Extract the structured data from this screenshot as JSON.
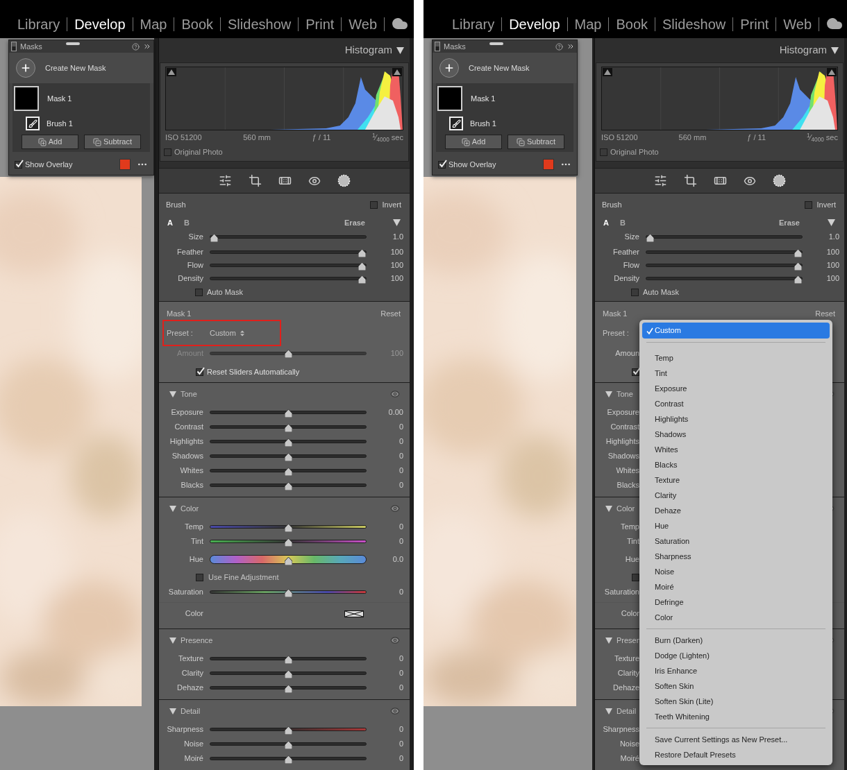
{
  "screens": [
    {
      "modules": [
        {
          "label": "Library",
          "selected": false
        },
        {
          "label": "Develop",
          "selected": true
        },
        {
          "label": "Map",
          "selected": false
        },
        {
          "label": "Book",
          "selected": false
        },
        {
          "label": "Slideshow",
          "selected": false
        },
        {
          "label": "Print",
          "selected": false
        },
        {
          "label": "Web",
          "selected": false
        }
      ],
      "masks_panel": {
        "title": "Masks",
        "create": "Create New Mask",
        "masks": [
          {
            "name": "Mask 1",
            "components": [
              {
                "name": "Brush 1"
              }
            ]
          }
        ],
        "add": "Add",
        "subtract": "Subtract",
        "show_overlay": {
          "label": "Show Overlay",
          "checked": true
        }
      },
      "histogram": {
        "title": "Histogram",
        "info": [
          "ISO 51200",
          "560 mm",
          "ƒ / 11",
          "$^{1}$⁄$_{4000}$ sec"
        ],
        "original_photo": {
          "label": "Original Photo",
          "checked": false
        }
      },
      "brush": {
        "title": "Brush",
        "invert": {
          "label": "Invert",
          "checked": false
        },
        "tabs": [
          {
            "label": "A",
            "selected": true
          },
          {
            "label": "B",
            "selected": false
          }
        ],
        "erase": "Erase",
        "sliders": [
          {
            "label": "Size",
            "value": "1.0",
            "level": 0.03
          },
          {
            "label": "Feather",
            "value": "100",
            "level": 0.97
          },
          {
            "label": "Flow",
            "value": "100",
            "level": 0.97
          },
          {
            "label": "Density",
            "value": "100",
            "level": 0.97
          }
        ],
        "auto_mask": {
          "label": "Auto Mask",
          "checked": false
        }
      },
      "mask": {
        "title": "Mask 1",
        "reset": "Reset",
        "highlighted": true,
        "preset": {
          "label": "Preset :",
          "value": "Custom"
        },
        "amount": {
          "label": "Amount",
          "value": "100",
          "level": 0.5,
          "disabled": true
        },
        "reset_sliders": {
          "label": "Reset Sliders Automatically",
          "checked": true
        }
      },
      "sections": [
        {
          "title": "Tone",
          "expanded": true,
          "rows": [
            {
              "kind": "slider",
              "label": "Exposure",
              "value": "0.00",
              "level": 0.5
            },
            {
              "kind": "slider",
              "label": "Contrast",
              "value": "0",
              "level": 0.5
            },
            {
              "kind": "slider",
              "label": "Highlights",
              "value": "0",
              "level": 0.5
            },
            {
              "kind": "slider",
              "label": "Shadows",
              "value": "0",
              "level": 0.5
            },
            {
              "kind": "slider",
              "label": "Whites",
              "value": "0",
              "level": 0.5
            },
            {
              "kind": "slider",
              "label": "Blacks",
              "value": "0",
              "level": 0.5
            }
          ]
        },
        {
          "title": "Color",
          "expanded": true,
          "rows": [
            {
              "kind": "temp_slider",
              "label": "Temp",
              "value": "0",
              "level": 0.5
            },
            {
              "kind": "tint_slider",
              "label": "Tint",
              "value": "0",
              "level": 0.5
            },
            {
              "kind": "hue_slider",
              "label": "Hue",
              "value": "0.0",
              "level": 0.5
            },
            {
              "kind": "checkbox",
              "label": "Use Fine Adjustment",
              "checked": false
            },
            {
              "kind": "saturation_slider",
              "label": "Saturation",
              "value": "0",
              "level": 0.5
            },
            {
              "kind": "swatch",
              "label": "Color"
            }
          ]
        },
        {
          "title": "Presence",
          "expanded": true,
          "rows": [
            {
              "kind": "slider",
              "label": "Texture",
              "value": "0",
              "level": 0.5
            },
            {
              "kind": "slider",
              "label": "Clarity",
              "value": "0",
              "level": 0.5
            },
            {
              "kind": "slider",
              "label": "Dehaze",
              "value": "0",
              "level": 0.5
            }
          ]
        },
        {
          "title": "Detail",
          "expanded": true,
          "rows": [
            {
              "kind": "sharpness_slider",
              "label": "Sharpness",
              "value": "0",
              "level": 0.5
            },
            {
              "kind": "slider",
              "label": "Noise",
              "value": "0",
              "level": 0.5
            },
            {
              "kind": "slider",
              "label": "Moiré",
              "value": "0",
              "level": 0.5
            }
          ]
        }
      ]
    },
    {
      "modules": [
        {
          "label": "Library",
          "selected": false
        },
        {
          "label": "Develop",
          "selected": true
        },
        {
          "label": "Map",
          "selected": false
        },
        {
          "label": "Book",
          "selected": false
        },
        {
          "label": "Slideshow",
          "selected": false
        },
        {
          "label": "Print",
          "selected": false
        },
        {
          "label": "Web",
          "selected": false
        }
      ],
      "masks_panel": {
        "title": "Masks",
        "create": "Create New Mask",
        "masks": [
          {
            "name": "Mask 1",
            "components": [
              {
                "name": "Brush 1"
              }
            ]
          }
        ],
        "add": "Add",
        "subtract": "Subtract",
        "show_overlay": {
          "label": "Show Overlay",
          "checked": true
        }
      },
      "histogram": {
        "title": "Histogram",
        "info": [
          "ISO 51200",
          "560 mm",
          "ƒ / 11",
          "$^{1}$⁄$_{4000}$ sec"
        ],
        "original_photo": {
          "label": "Original Photo",
          "checked": false
        }
      },
      "brush": {
        "title": "Brush",
        "invert": {
          "label": "Invert",
          "checked": false
        },
        "tabs": [
          {
            "label": "A",
            "selected": true
          },
          {
            "label": "B",
            "selected": false
          }
        ],
        "erase": "Erase",
        "sliders": [
          {
            "label": "Size",
            "value": "1.0",
            "level": 0.03
          },
          {
            "label": "Feather",
            "value": "100",
            "level": 0.97
          },
          {
            "label": "Flow",
            "value": "100",
            "level": 0.97
          },
          {
            "label": "Density",
            "value": "100",
            "level": 0.97
          }
        ],
        "auto_mask": {
          "label": "Auto Mask",
          "checked": false
        }
      },
      "mask": {
        "title": "Mask 1",
        "reset": "Reset",
        "highlighted": false,
        "preset": {
          "label": "Preset :"
        },
        "amount": {
          "label": "Amoun"
        },
        "reset_sliders": {
          "checked": true
        }
      },
      "sections": [
        {
          "title": "Tone",
          "expanded": true,
          "rows": [
            {
              "kind": "slider",
              "label": "Exposure"
            },
            {
              "kind": "slider",
              "label": "Contrast"
            },
            {
              "kind": "slider",
              "label": "Highlights"
            },
            {
              "kind": "slider",
              "label": "Shadows"
            },
            {
              "kind": "slider",
              "label": "Whites"
            },
            {
              "kind": "slider",
              "label": "Blacks"
            }
          ]
        },
        {
          "title": "Color",
          "expanded": true,
          "rows": [
            {
              "kind": "temp_slider",
              "label": "Temp"
            },
            {
              "kind": "tint_slider",
              "label": "Tint"
            },
            {
              "kind": "hue_slider",
              "label": "Hue"
            },
            {
              "kind": "checkbox",
              "checked": false
            },
            {
              "kind": "saturation_slider",
              "label": "Saturation"
            },
            {
              "kind": "swatch",
              "label": "Color"
            }
          ]
        },
        {
          "title": "Presen",
          "expanded": true,
          "rows": [
            {
              "kind": "slider",
              "label": "Texture"
            },
            {
              "kind": "slider",
              "label": "Clarity"
            },
            {
              "kind": "slider",
              "label": "Dehaze"
            }
          ]
        },
        {
          "title": "Detail",
          "expanded": true,
          "rows": [
            {
              "kind": "sharpness_slider",
              "label": "Sharpness"
            },
            {
              "kind": "slider",
              "label": "Noise"
            },
            {
              "kind": "slider",
              "label": "Moiré"
            }
          ]
        }
      ],
      "dropdown": {
        "groups": [
          [
            {
              "label": "Custom",
              "selected": true
            }
          ],
          [
            {
              "label": "Temp",
              "selected": false
            },
            {
              "label": "Tint",
              "selected": false
            },
            {
              "label": "Exposure",
              "selected": false
            },
            {
              "label": "Contrast",
              "selected": false
            },
            {
              "label": "Highlights",
              "selected": false
            },
            {
              "label": "Shadows",
              "selected": false
            },
            {
              "label": "Whites",
              "selected": false
            },
            {
              "label": "Blacks",
              "selected": false
            },
            {
              "label": "Texture",
              "selected": false
            },
            {
              "label": "Clarity",
              "selected": false
            },
            {
              "label": "Dehaze",
              "selected": false
            },
            {
              "label": "Hue",
              "selected": false
            },
            {
              "label": "Saturation",
              "selected": false
            },
            {
              "label": "Sharpness",
              "selected": false
            },
            {
              "label": "Noise",
              "selected": false
            },
            {
              "label": "Moiré",
              "selected": false
            },
            {
              "label": "Defringe",
              "selected": false
            },
            {
              "label": "Color",
              "selected": false
            }
          ],
          [
            {
              "label": "Burn (Darken)",
              "selected": false
            },
            {
              "label": "Dodge (Lighten)",
              "selected": false
            },
            {
              "label": "Iris Enhance",
              "selected": false
            },
            {
              "label": "Soften Skin",
              "selected": false
            },
            {
              "label": "Soften Skin (Lite)",
              "selected": false
            },
            {
              "label": "Teeth Whitening",
              "selected": false
            }
          ],
          [
            {
              "label": "Save Current Settings as New Preset...",
              "selected": false
            },
            {
              "label": "Restore Default Presets",
              "selected": false
            }
          ]
        ]
      }
    }
  ]
}
